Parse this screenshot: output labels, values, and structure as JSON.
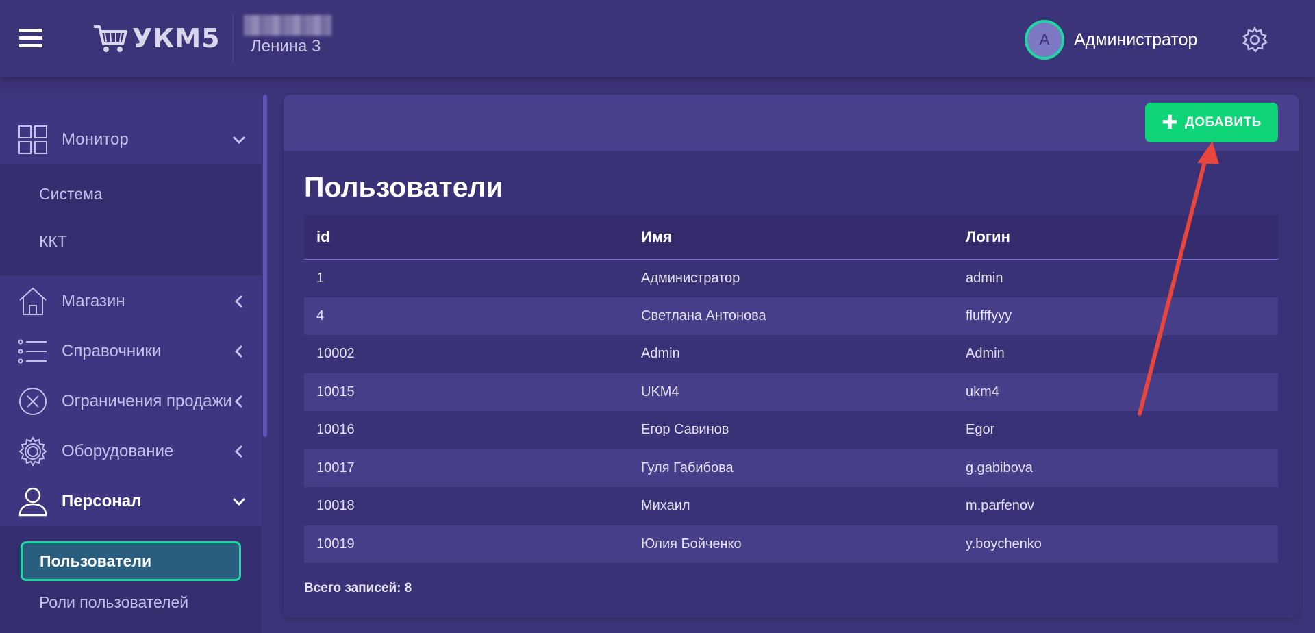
{
  "header": {
    "logo_text": "УКМ5",
    "store_address": "Ленина 3",
    "avatar_letter": "А",
    "user_name": "Администратор",
    "icons": [
      "menu-icon",
      "cart-icon",
      "gear-icon"
    ]
  },
  "sidebar": {
    "items": [
      {
        "label": "Монитор",
        "icon": "grid-icon",
        "state": "expanded"
      },
      {
        "label": "Магазин",
        "icon": "house-icon",
        "state": "collapsed"
      },
      {
        "label": "Справочники",
        "icon": "list-icon",
        "state": "collapsed"
      },
      {
        "label": "Ограничения продажи",
        "icon": "circle-x-icon",
        "state": "collapsed"
      },
      {
        "label": "Оборудование",
        "icon": "gear-icon",
        "state": "collapsed"
      },
      {
        "label": "Персонал",
        "icon": "person-icon",
        "state": "expanded"
      }
    ],
    "monitor_sub": [
      "Система",
      "ККТ"
    ],
    "staff_sub": [
      "Пользователи",
      "Роли пользователей"
    ],
    "selected": "Пользователи"
  },
  "main": {
    "add_button_label": "ДОБАВИТЬ",
    "title": "Пользователи",
    "table": {
      "headers": [
        "id",
        "Имя",
        "Логин"
      ],
      "rows": [
        [
          "1",
          "Администратор",
          "admin"
        ],
        [
          "4",
          "Светлана Антонова",
          "flufffyyy"
        ],
        [
          "10002",
          "Admin",
          "Admin"
        ],
        [
          "10015",
          "UKM4",
          "ukm4"
        ],
        [
          "10016",
          "Егор Савинов",
          "Egor"
        ],
        [
          "10017",
          "Гуля Габибова",
          "g.gabibova"
        ],
        [
          "10018",
          "Михаил",
          "m.parfenov"
        ],
        [
          "10019",
          "Юлия Бойченко",
          "y.boychenko"
        ]
      ]
    },
    "total_label": "Всего записей:",
    "total_count": "8"
  },
  "colors": {
    "background": "#3c3478",
    "accent_green": "#0fd377",
    "selected_border": "#1fd6a0",
    "annotation_arrow": "#e8453c"
  }
}
